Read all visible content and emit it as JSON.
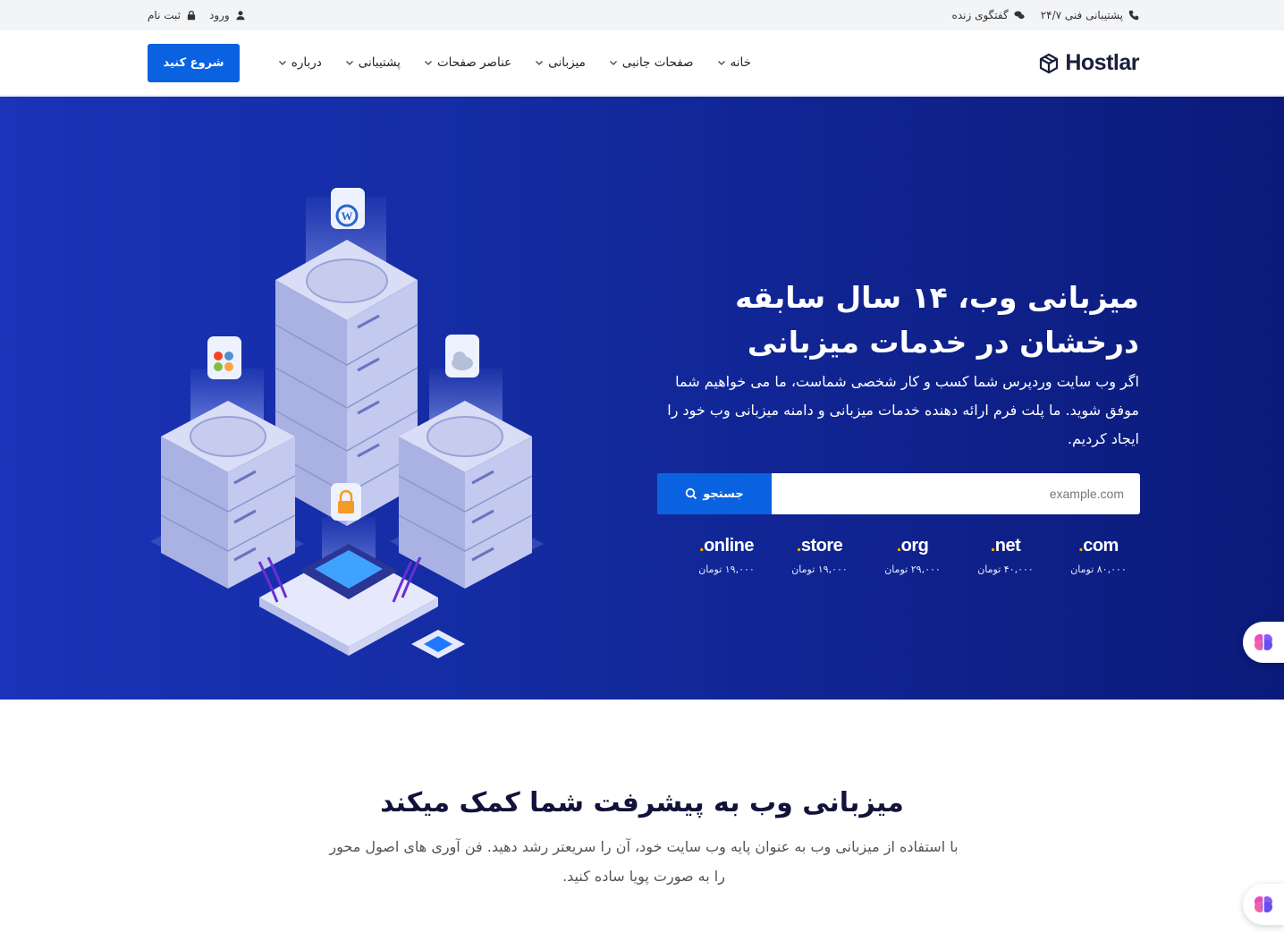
{
  "topbar": {
    "phone_label": "پشتیبانی فنی ۲۴/۷",
    "chat_label": "گفتگوی زنده",
    "login_label": "ورود",
    "register_label": "ثبت نام"
  },
  "nav": {
    "logo_text": "Hostlar",
    "items": [
      {
        "label": "خانه"
      },
      {
        "label": "صفحات جانبی"
      },
      {
        "label": "میزبانی"
      },
      {
        "label": "عناصر صفحات"
      },
      {
        "label": "پشتیبانی"
      },
      {
        "label": "درباره"
      }
    ],
    "cta_label": "شروع کنید"
  },
  "hero": {
    "title_line1": "میزبانی وب، ۱۴ سال سابقه",
    "title_line2": "درخشان در خدمات میزبانی",
    "description": "اگر وب سایت وردپرس شما کسب و کار شخصی شماست، ما می خواهیم شما موفق شوید. ما پلت فرم ارائه دهنده خدمات میزبانی و دامنه میزبانی وب خود را ایجاد کردیم.",
    "search_placeholder": "example.com",
    "search_button": "جستجو",
    "domains": [
      {
        "ext": "com",
        "price": "۸۰,۰۰۰ تومان"
      },
      {
        "ext": "net",
        "price": "۴۰,۰۰۰ تومان"
      },
      {
        "ext": "org",
        "price": "۲۹,۰۰۰ تومان"
      },
      {
        "ext": "store",
        "price": "۱۹,۰۰۰ تومان"
      },
      {
        "ext": "online",
        "price": "۱۹,۰۰۰ تومان"
      }
    ]
  },
  "section": {
    "title": "میزبانی وب به پیشرفت شما کمک میکند",
    "description": "با استفاده از میزبانی وب به عنوان پایه وب سایت خود، آن را سریعتر رشد دهید. فن آوری های اصول محور را به صورت پویا ساده کنید."
  },
  "colors": {
    "brand_blue": "#0b62e0",
    "hero_bg": "#132a9e",
    "accent_yellow": "#ffb200"
  },
  "icons": [
    "phone-icon",
    "chat-icon",
    "lock-icon",
    "user-icon",
    "search-icon",
    "chevron-down-icon",
    "brain-icon"
  ]
}
